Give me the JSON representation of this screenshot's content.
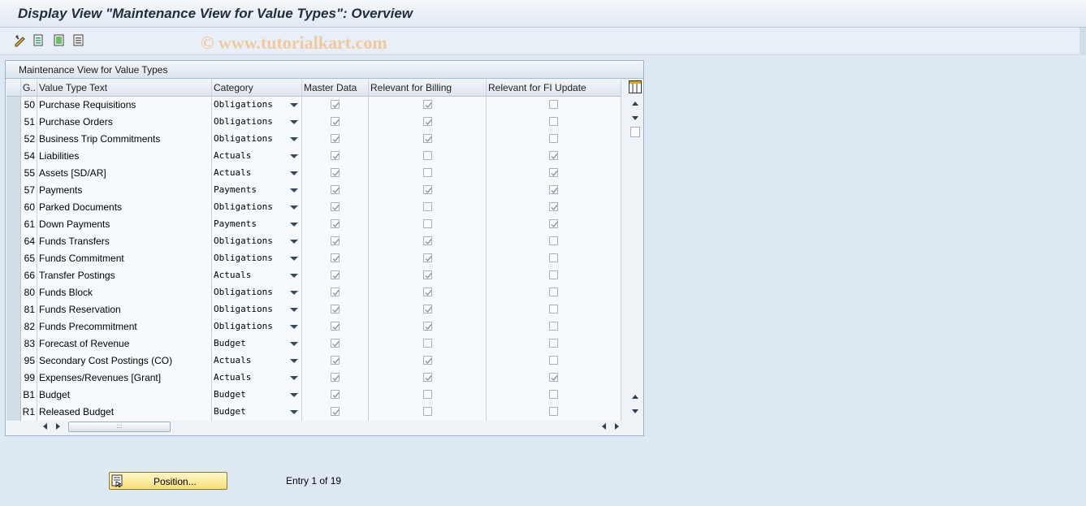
{
  "title": "Display View \"Maintenance View for Value Types\": Overview",
  "watermark": "© www.tutorialkart.com",
  "toolbar": {
    "icons": [
      "display-change-icon",
      "details-icon",
      "select-all-icon",
      "deselect-icon"
    ]
  },
  "table": {
    "caption": "Maintenance View for Value Types",
    "headers": {
      "group": "G..",
      "text": "Value Type Text",
      "category": "Category",
      "master": "Master Data",
      "billing": "Relevant for Billing",
      "fi": "Relevant for FI Update"
    },
    "rows": [
      {
        "g": "50",
        "text": "Purchase Requisitions",
        "cat": "Obligations",
        "md": true,
        "bill": true,
        "fi": false
      },
      {
        "g": "51",
        "text": "Purchase Orders",
        "cat": "Obligations",
        "md": true,
        "bill": true,
        "fi": false
      },
      {
        "g": "52",
        "text": "Business Trip Commitments",
        "cat": "Obligations",
        "md": true,
        "bill": true,
        "fi": false
      },
      {
        "g": "54",
        "text": "Liabilities",
        "cat": "Actuals",
        "md": true,
        "bill": false,
        "fi": true
      },
      {
        "g": "55",
        "text": "Assets [SD/AR]",
        "cat": "Actuals",
        "md": true,
        "bill": false,
        "fi": true
      },
      {
        "g": "57",
        "text": "Payments",
        "cat": "Payments",
        "md": true,
        "bill": true,
        "fi": true
      },
      {
        "g": "60",
        "text": "Parked Documents",
        "cat": "Obligations",
        "md": true,
        "bill": false,
        "fi": true
      },
      {
        "g": "61",
        "text": "Down Payments",
        "cat": "Payments",
        "md": true,
        "bill": false,
        "fi": true
      },
      {
        "g": "64",
        "text": "Funds Transfers",
        "cat": "Obligations",
        "md": true,
        "bill": true,
        "fi": false
      },
      {
        "g": "65",
        "text": "Funds Commitment",
        "cat": "Obligations",
        "md": true,
        "bill": true,
        "fi": false
      },
      {
        "g": "66",
        "text": "Transfer Postings",
        "cat": "Actuals",
        "md": true,
        "bill": true,
        "fi": false
      },
      {
        "g": "80",
        "text": "Funds Block",
        "cat": "Obligations",
        "md": true,
        "bill": true,
        "fi": false
      },
      {
        "g": "81",
        "text": "Funds Reservation",
        "cat": "Obligations",
        "md": true,
        "bill": true,
        "fi": false
      },
      {
        "g": "82",
        "text": "Funds Precommitment",
        "cat": "Obligations",
        "md": true,
        "bill": true,
        "fi": false
      },
      {
        "g": "83",
        "text": "Forecast of Revenue",
        "cat": "Budget",
        "md": true,
        "bill": false,
        "fi": false
      },
      {
        "g": "95",
        "text": "Secondary Cost Postings (CO)",
        "cat": "Actuals",
        "md": true,
        "bill": true,
        "fi": false
      },
      {
        "g": "99",
        "text": "Expenses/Revenues [Grant]",
        "cat": "Actuals",
        "md": true,
        "bill": true,
        "fi": true
      },
      {
        "g": "B1",
        "text": "Budget",
        "cat": "Budget",
        "md": true,
        "bill": false,
        "fi": false
      },
      {
        "g": "R1",
        "text": "Released Budget",
        "cat": "Budget",
        "md": true,
        "bill": false,
        "fi": false
      }
    ]
  },
  "position_button": "Position...",
  "entry_text": "Entry 1 of 19",
  "colors": {
    "background": "#dfe9f3",
    "button": "#f7dd7a",
    "title": "#1f2d3d"
  }
}
